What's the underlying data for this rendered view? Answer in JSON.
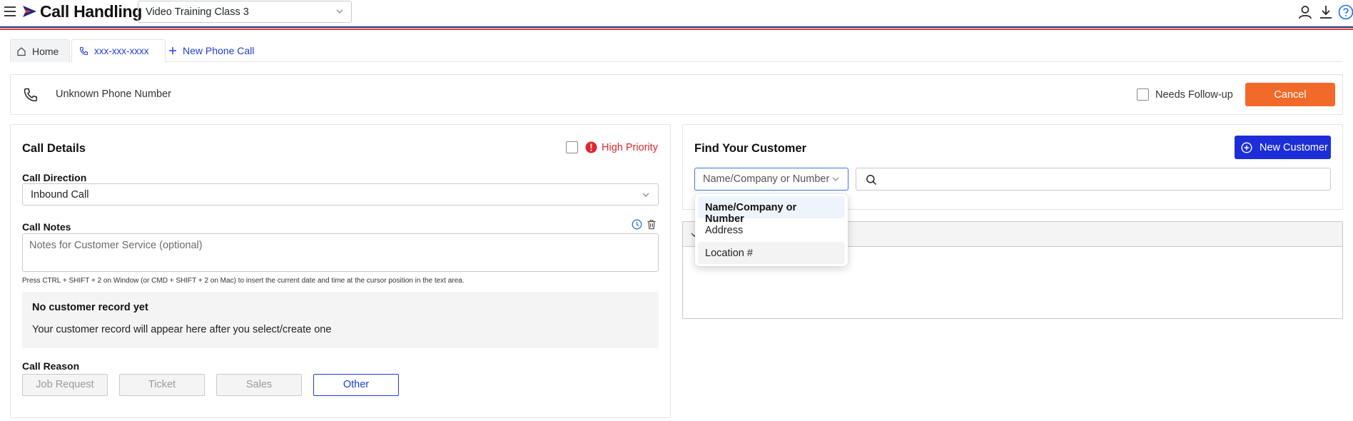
{
  "app": {
    "title": "Call Handling",
    "class_select_value": "Video Training Class 3"
  },
  "tabs": {
    "home": "Home",
    "phone": "xxx-xxx-xxxx",
    "new_call": "New Phone Call"
  },
  "call_bar": {
    "caller": "Unknown Phone Number",
    "needs_followup_label": "Needs Follow-up",
    "cancel_label": "Cancel"
  },
  "call_details": {
    "title": "Call Details",
    "high_priority_label": "High Priority",
    "direction_label": "Call Direction",
    "direction_value": "Inbound Call",
    "notes_label": "Call Notes",
    "notes_placeholder": "Notes for Customer Service (optional)",
    "notes_hint": "Press CTRL + SHIFT + 2 on Window (or CMD + SHIFT + 2 on Mac) to insert the current date and time at the cursor position in the text area.",
    "no_record_title": "No customer record yet",
    "no_record_text": "Your customer record will appear here after you select/create one",
    "reason_label": "Call Reason",
    "reasons": [
      "Job Request",
      "Ticket",
      "Sales",
      "Other"
    ],
    "selected_reason": "Other"
  },
  "find_customer": {
    "title": "Find Your Customer",
    "new_customer_label": "New Customer",
    "search_type_value": "Name/Company or Number",
    "search_type_options": [
      "Name/Company or Number",
      "Address",
      "Location #"
    ]
  },
  "colors": {
    "accent_blue": "#1d2ed8",
    "cancel_orange": "#f26a2a",
    "priority_red": "#e0262f",
    "stripe_navy": "#1e2a78",
    "stripe_red": "#d23a3a"
  },
  "icons": {
    "menu": "hamburger-icon",
    "brand": "flag-logo-icon",
    "user": "user-icon",
    "download": "download-icon",
    "help": "help-icon",
    "home": "home-icon",
    "phone": "phone-icon",
    "add": "plus-icon",
    "history": "clock-icon",
    "delete": "trash-icon",
    "search": "search-icon",
    "warning": "alert-icon"
  }
}
